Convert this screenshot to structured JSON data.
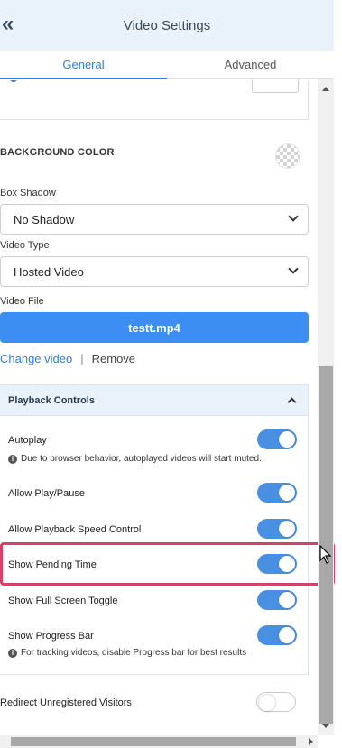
{
  "header": {
    "title": "Video Settings",
    "back_icon": "chevrons-left-icon"
  },
  "tabs": [
    {
      "label": "General",
      "active": true
    },
    {
      "label": "Advanced",
      "active": false
    }
  ],
  "background": {
    "label": "BACKGROUND COLOR"
  },
  "box_shadow": {
    "label": "Box Shadow",
    "value": "No Shadow"
  },
  "video_type": {
    "label": "Video Type",
    "value": "Hosted Video"
  },
  "video_file": {
    "label": "Video File",
    "filename": "testt.mp4",
    "change_label": "Change video",
    "separator": "|",
    "remove_label": "Remove"
  },
  "playback": {
    "title": "Playback Controls",
    "autoplay": {
      "label": "Autoplay",
      "on": true,
      "note": "Due to browser behavior, autoplayed videos will start muted."
    },
    "play_pause": {
      "label": "Allow Play/Pause",
      "on": true
    },
    "speed": {
      "label": "Allow Playback Speed Control",
      "on": true
    },
    "pending_time": {
      "label": "Show Pending Time",
      "on": true
    },
    "fullscreen": {
      "label": "Show Full Screen Toggle",
      "on": true
    },
    "progress": {
      "label": "Show Progress Bar",
      "on": true,
      "note": "For tracking videos, disable Progress bar for best results"
    }
  },
  "redirect": {
    "label": "Redirect Unregistered Visitors",
    "on": false
  },
  "colors": {
    "accent": "#2f7be3",
    "toggle_on": "#4a90e2",
    "highlight": "#d2436a",
    "header_bg": "#e9f1fb"
  }
}
